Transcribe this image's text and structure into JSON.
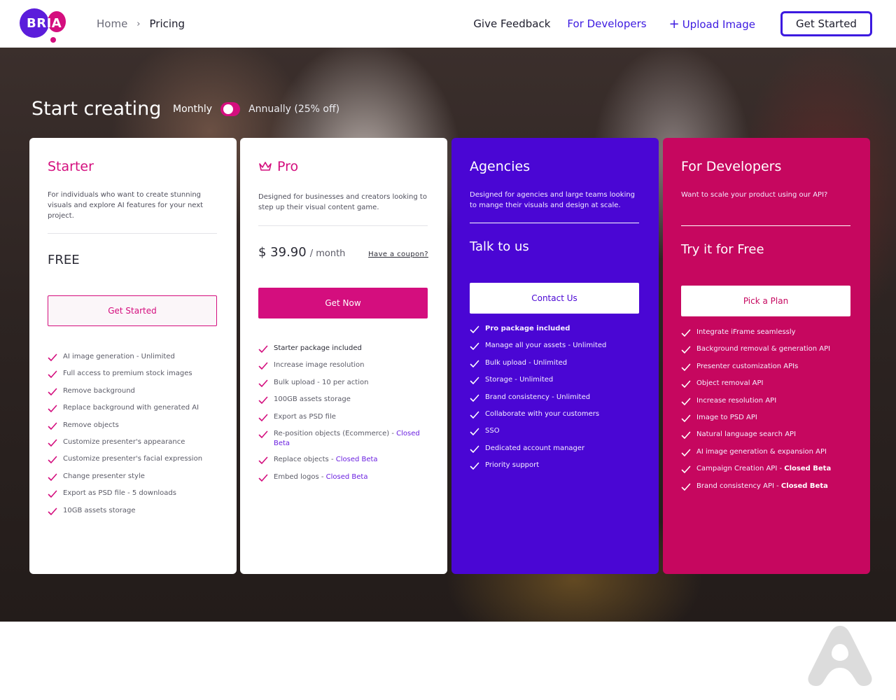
{
  "header": {
    "logo_text": "BRIA",
    "breadcrumb": {
      "home": "Home",
      "separator": "›",
      "current": "Pricing"
    },
    "nav": {
      "feedback": "Give Feedback",
      "developers": "For Developers",
      "upload_plus": "+",
      "upload": "Upload Image",
      "get_started": "Get Started"
    }
  },
  "hero": {
    "title": "Start creating",
    "billing": {
      "monthly": "Monthly",
      "annually": "Annually (25% off)",
      "annual_selected": false
    }
  },
  "colors": {
    "brand_purple": "#4a06d4",
    "brand_pink": "#d40e7e",
    "dev_pink": "#c6075f"
  },
  "plans": {
    "starter": {
      "name": "Starter",
      "description": "For individuals who want to create stunning visuals and explore AI features for your next project.",
      "price": "FREE",
      "cta": "Get Started",
      "features": [
        "AI image generation - Unlimited",
        "Full access to premium stock images",
        "Remove background",
        "Replace background with generated AI",
        "Remove objects",
        "Customize presenter's appearance",
        "Customize presenter's facial expression",
        "Change presenter style",
        "Export as PSD file - 5 downloads",
        "10GB assets storage"
      ]
    },
    "pro": {
      "name": "Pro",
      "icon": "crown-icon",
      "description": "Designed for businesses and creators looking to step up their visual content game.",
      "price": "$ 39.90",
      "period": "/ month",
      "coupon": "Have a coupon?",
      "cta": "Get Now",
      "features": [
        {
          "text": "Starter package included",
          "beta": ""
        },
        {
          "text": "Increase image resolution",
          "beta": ""
        },
        {
          "text": "Bulk upload - 10 per action",
          "beta": ""
        },
        {
          "text": "100GB assets storage",
          "beta": ""
        },
        {
          "text": "Export as PSD file",
          "beta": ""
        },
        {
          "text": "Re-position objects (Ecommerce) -",
          "beta": "Closed Beta"
        },
        {
          "text": "Replace objects -",
          "beta": "Closed Beta"
        },
        {
          "text": "Embed logos -",
          "beta": "Closed Beta"
        }
      ]
    },
    "agencies": {
      "name": "Agencies",
      "description": "Designed for agencies and large teams looking to mange their visuals and design at scale.",
      "headline": "Talk to us",
      "cta": "Contact Us",
      "features": [
        "Pro package included",
        "Manage all your assets - Unlimited",
        "Bulk upload - Unlimited",
        "Storage - Unlimited",
        "Brand consistency - Unlimited",
        "Collaborate with your customers",
        "SSO",
        "Dedicated account manager",
        "Priority support"
      ]
    },
    "developers": {
      "name": "For Developers",
      "description": "Want to scale your product using our API?",
      "headline": "Try it for Free",
      "cta": "Pick a Plan",
      "features": [
        {
          "text": "Integrate iFrame seamlessly",
          "beta": ""
        },
        {
          "text": "Background removal & generation API",
          "beta": ""
        },
        {
          "text": "Presenter customization APIs",
          "beta": ""
        },
        {
          "text": "Object removal API",
          "beta": ""
        },
        {
          "text": "Increase resolution API",
          "beta": ""
        },
        {
          "text": "Image to PSD API",
          "beta": ""
        },
        {
          "text": "Natural language search API",
          "beta": ""
        },
        {
          "text": "AI image generation & expansion API",
          "beta": ""
        },
        {
          "text": "Campaign Creation API -",
          "beta": "Closed Beta"
        },
        {
          "text": "Brand consistency API -",
          "beta": "Closed Beta"
        }
      ]
    }
  },
  "footer": {
    "watermark_icon": "bria-a-logo-icon"
  }
}
